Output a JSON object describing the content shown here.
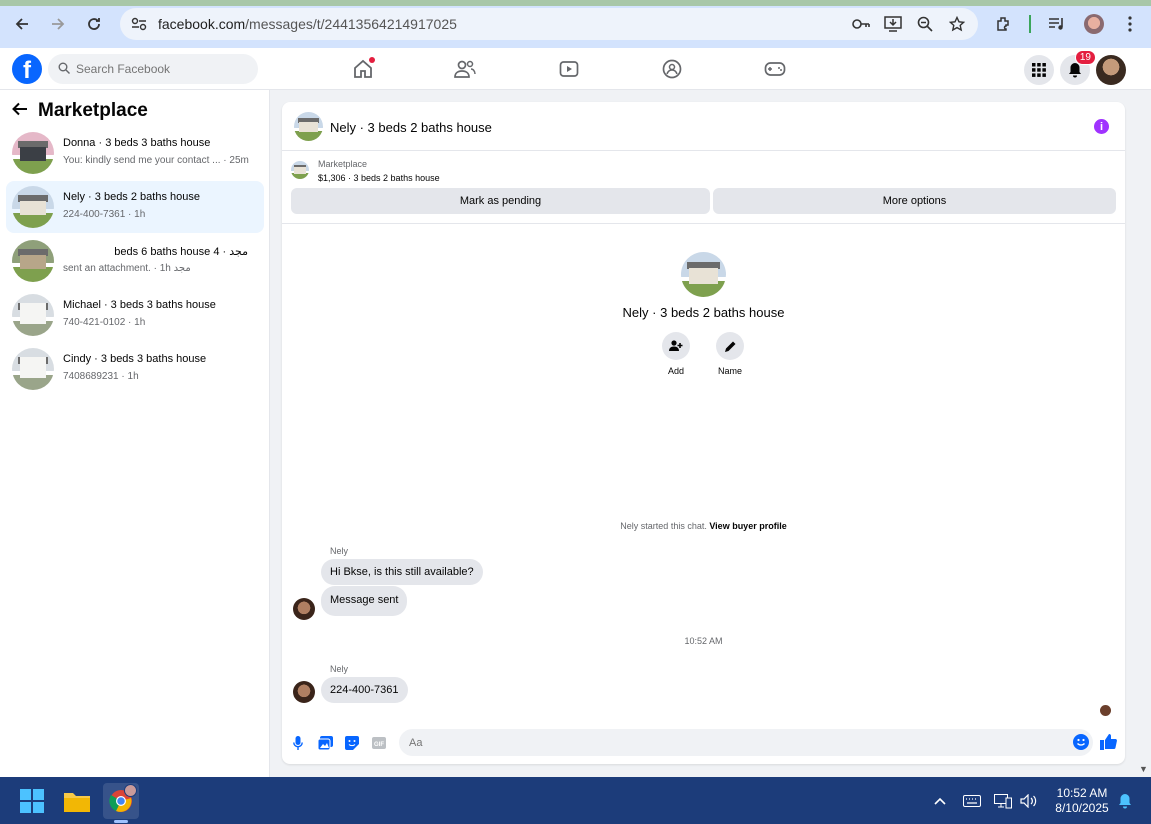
{
  "browser": {
    "url_domain": "facebook.com",
    "url_path": "/messages/t/24413564214917025"
  },
  "fb_nav": {
    "logo": "f",
    "search_placeholder": "Search Facebook",
    "notification_count": "19"
  },
  "sidebar": {
    "title": "Marketplace",
    "conversations": [
      {
        "name": "Donna · 3 beds 3 baths house",
        "sub": "You: kindly send me your contact ... · 25m",
        "thumb": "dark"
      },
      {
        "name": "Nely · 3 beds 2 baths house",
        "sub": "224-400-7361 · 1h",
        "thumb": "ranch"
      },
      {
        "name": "مجد · 4 beds 6 baths house",
        "sub": "مجد sent an attachment. · 1h",
        "thumb": "trees"
      },
      {
        "name": "Michael · 3 beds 3 baths house",
        "sub": "740-421-0102 · 1h",
        "thumb": "white"
      },
      {
        "name": "Cindy · 3 beds 3 baths house",
        "sub": "7408689231 · 1h",
        "thumb": "white"
      }
    ]
  },
  "chat": {
    "title": "Nely · 3 beds 2 baths house",
    "listing_label": "Marketplace",
    "listing_price": "$1,306 · 3 beds 2 baths house",
    "mark_pending": "Mark as pending",
    "more_options": "More options",
    "profile_name": "Nely · 3 beds 2 baths house",
    "add_label": "Add",
    "name_label": "Name",
    "system_message": "Nely started this chat. ",
    "view_buyer_profile": "View buyer profile",
    "messages": [
      {
        "sender": "Nely",
        "text": "Hi Bkse, is this still available?"
      },
      {
        "text": "Message sent"
      },
      {
        "sender": "Nely",
        "text": "224-400-7361"
      }
    ],
    "timestamp": "10:52 AM",
    "composer_placeholder": "Aa"
  },
  "taskbar": {
    "time": "10:52 AM",
    "date": "8/10/2025"
  },
  "colors": {
    "fb_blue": "#0866ff",
    "info_purple": "#a033ff",
    "taskbar_bg": "#1c3c7a"
  }
}
